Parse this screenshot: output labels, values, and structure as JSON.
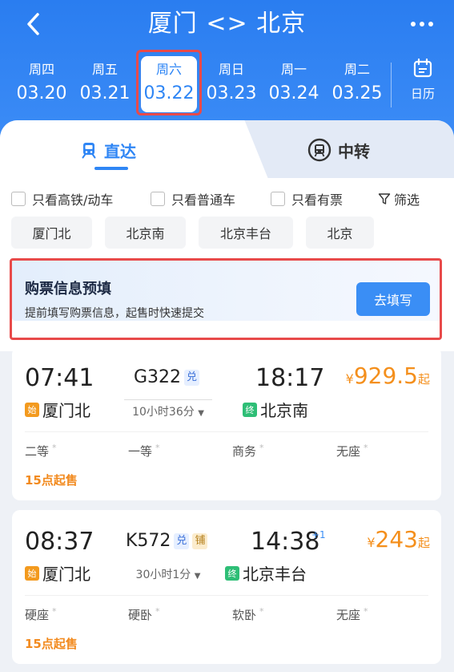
{
  "header": {
    "title": "厦门 <> 北京",
    "back_icon": "chevron-left-icon",
    "more_icon": "more-dots-icon"
  },
  "dates": [
    {
      "dow": "周四",
      "md": "03.20"
    },
    {
      "dow": "周五",
      "md": "03.21"
    },
    {
      "dow": "周六",
      "md": "03.22",
      "selected": true
    },
    {
      "dow": "周日",
      "md": "03.23"
    },
    {
      "dow": "周一",
      "md": "03.24"
    },
    {
      "dow": "周二",
      "md": "03.25"
    }
  ],
  "calendar": {
    "label": "日历"
  },
  "tabs": {
    "direct": "直达",
    "transfer": "中转"
  },
  "filters": {
    "high_speed": "只看高铁/动车",
    "normal": "只看普通车",
    "available": "只看有票",
    "filter_btn": "筛选"
  },
  "stations": [
    "厦门北",
    "北京南",
    "北京丰台",
    "北京"
  ],
  "prefill": {
    "title": "购票信息预填",
    "subtitle": "提前填写购票信息，起售时快速提交",
    "button": "去填写"
  },
  "trains": [
    {
      "dep_time": "07:41",
      "arr_time": "18:17",
      "train_no": "G322",
      "badges": [
        "兑"
      ],
      "duration": "10小时36分",
      "from": "厦门北",
      "from_tag": "始",
      "to": "北京南",
      "to_tag": "终",
      "price_symbol": "¥",
      "price": "929.5",
      "price_suffix": "起",
      "seats": [
        "二等",
        "一等",
        "商务",
        "无座"
      ],
      "onsale": "15点起售"
    },
    {
      "dep_time": "08:37",
      "arr_time": "14:38",
      "arr_plus": "+1",
      "train_no": "K572",
      "badges": [
        "兑",
        "铺"
      ],
      "duration": "30小时1分",
      "from": "厦门北",
      "from_tag": "始",
      "to": "北京丰台",
      "to_tag": "终",
      "price_symbol": "¥",
      "price": "243",
      "price_suffix": "起",
      "seats": [
        "硬座",
        "硬卧",
        "软卧",
        "无座"
      ],
      "onsale": "15点起售"
    }
  ],
  "colors": {
    "primary": "#2f86f5",
    "price": "#f48f1c",
    "highlight": "#e84a4a"
  }
}
